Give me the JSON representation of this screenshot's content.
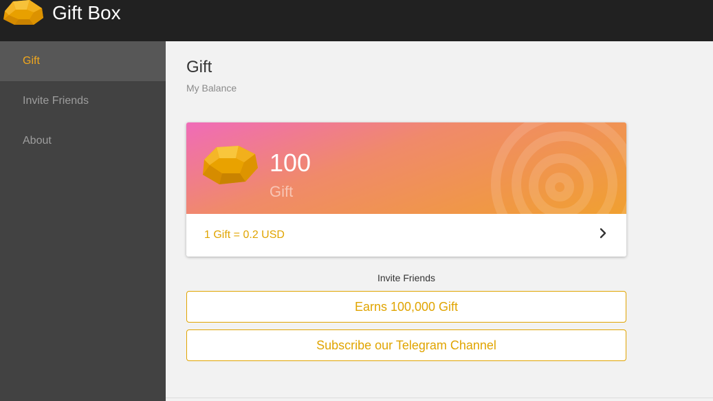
{
  "header": {
    "logo_icon": "gold-gem-icon",
    "title": "Gift Box"
  },
  "sidebar": {
    "items": [
      {
        "label": "Gift",
        "active": true
      },
      {
        "label": "Invite Friends",
        "active": false
      },
      {
        "label": "About",
        "active": false
      }
    ]
  },
  "main": {
    "title": "Gift",
    "subtitle": "My Balance",
    "balance_card": {
      "icon": "gold-gem-icon",
      "amount": "100",
      "unit": "Gift",
      "rate": "1 Gift = 0.2 USD",
      "chevron_icon": "chevron-right-icon"
    },
    "invite_caption": "Invite Friends",
    "buttons": {
      "earn": "Earns 100,000 Gift",
      "telegram": "Subscribe our Telegram Channel"
    }
  },
  "colors": {
    "accent": "#f2a81d",
    "gradient_start": "#f06bb8",
    "gradient_end": "#f0a030",
    "header_bg": "#212121",
    "sidebar_bg": "#424242",
    "sidebar_active_bg": "#575757"
  }
}
